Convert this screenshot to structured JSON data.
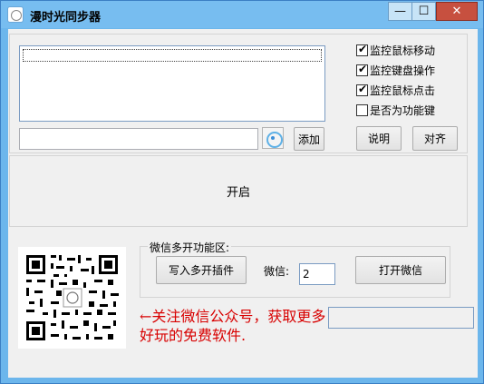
{
  "window": {
    "title": "漫时光同步器",
    "minimize_glyph": "—",
    "maximize_glyph": "☐",
    "close_glyph": "✕"
  },
  "options": {
    "items": [
      {
        "label": "监控鼠标移动",
        "checked": true
      },
      {
        "label": "监控键盘操作",
        "checked": true
      },
      {
        "label": "监控鼠标点击",
        "checked": true
      },
      {
        "label": "是否为功能键",
        "checked": false
      }
    ]
  },
  "buttons": {
    "add": "添加",
    "explain": "说明",
    "align": "对齐",
    "start": "开启",
    "write_plugin": "写入多开插件",
    "open_wechat": "打开微信"
  },
  "wechat_group": {
    "label": "微信多开功能区:",
    "count_label": "微信:",
    "count_value": "2"
  },
  "promo": {
    "text": "←关注微信公众号，获取更多好玩的免费软件."
  },
  "icons": {
    "target": "crosshair-target-icon",
    "qr": "qr-code"
  }
}
